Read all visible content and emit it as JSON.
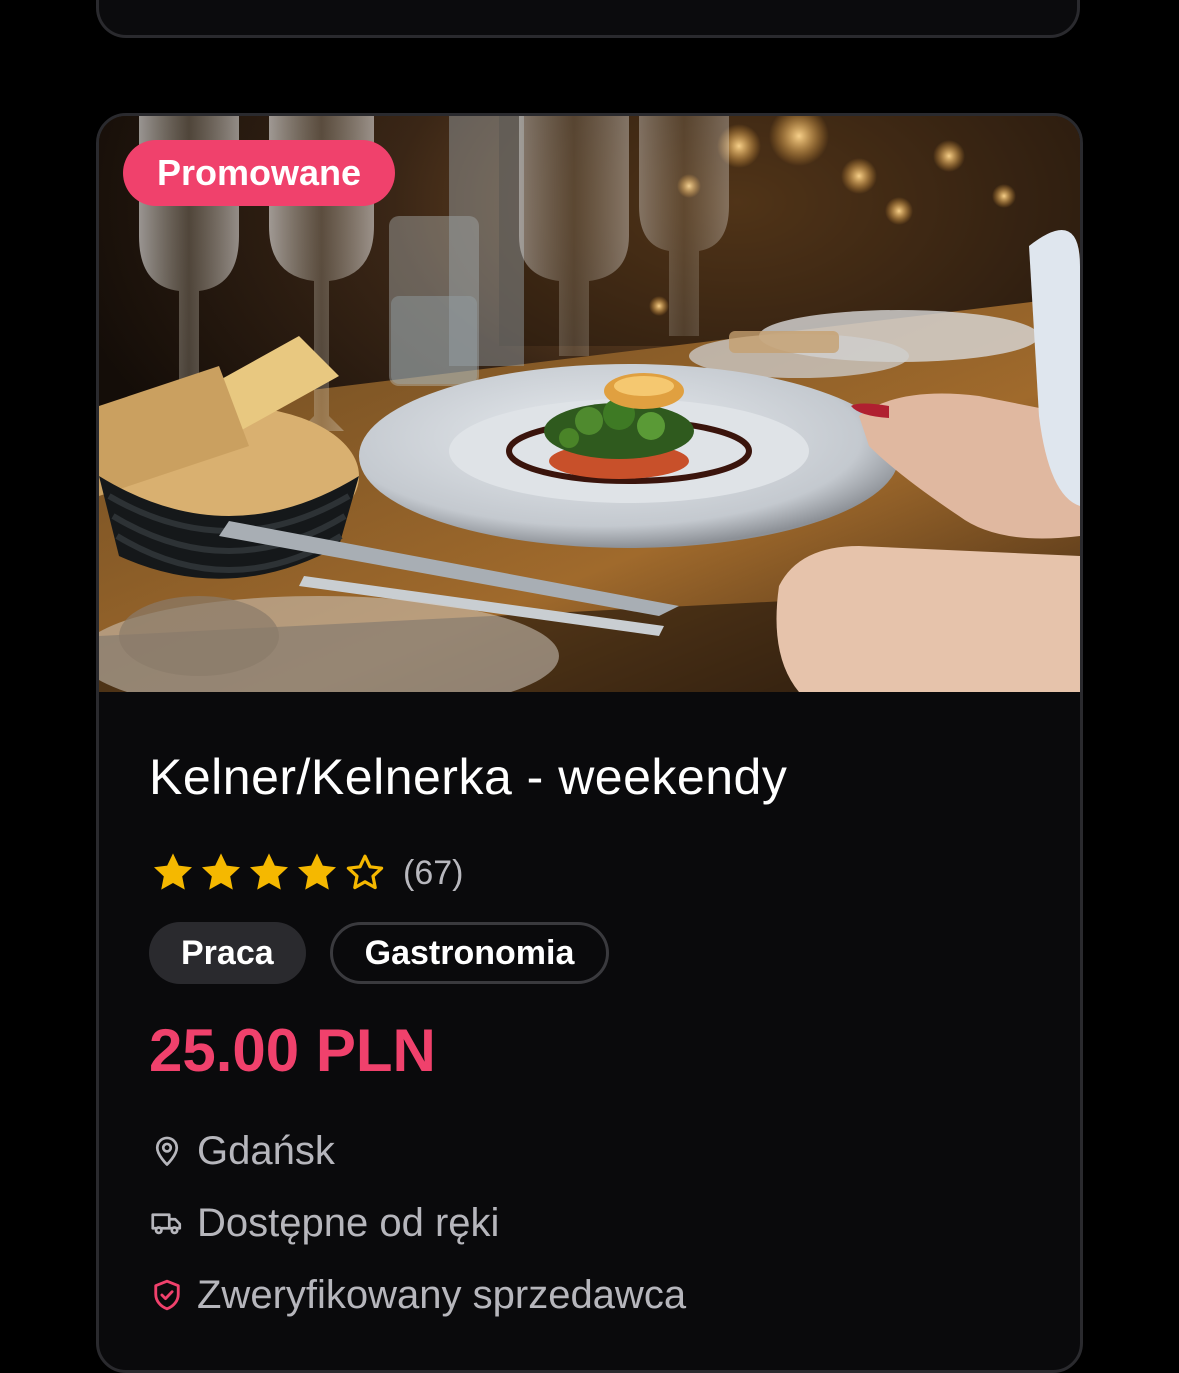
{
  "listing": {
    "badge": "Promowane",
    "title": "Kelner/Kelnerka - weekendy",
    "rating": {
      "stars_filled": 4,
      "stars_total": 5,
      "review_count": "(67)",
      "star_color": "#f5b800"
    },
    "tags": [
      "Praca",
      "Gastronomia"
    ],
    "price": "25.00 PLN",
    "details": {
      "location": "Gdańsk",
      "availability": "Dostępne od ręki",
      "seller": "Zweryfikowany sprzedawca"
    },
    "icons": {
      "location": "map-pin-icon",
      "availability": "truck-icon",
      "seller": "shield-check-icon"
    }
  },
  "colors": {
    "accent": "#f0416c",
    "background": "#000000",
    "card": "#0a0a0c"
  }
}
